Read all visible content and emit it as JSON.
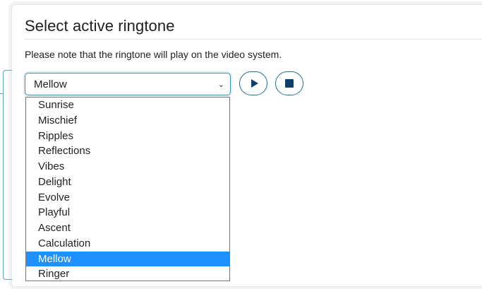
{
  "panel": {
    "title": "Select active ringtone",
    "note": "Please note that the ringtone will play on the video system."
  },
  "ringtone_select": {
    "value": "Mellow",
    "chevron": "chevron-down-icon",
    "options": [
      "Sunrise",
      "Mischief",
      "Ripples",
      "Reflections",
      "Vibes",
      "Delight",
      "Evolve",
      "Playful",
      "Ascent",
      "Calculation",
      "Mellow",
      "Ringer"
    ],
    "highlighted": "Mellow"
  },
  "controls": {
    "play_icon": "play-icon",
    "stop_icon": "stop-icon"
  },
  "colors": {
    "accent": "#1d6f98",
    "highlight": "#1e90ff",
    "focus_border": "#3a8fb5"
  }
}
